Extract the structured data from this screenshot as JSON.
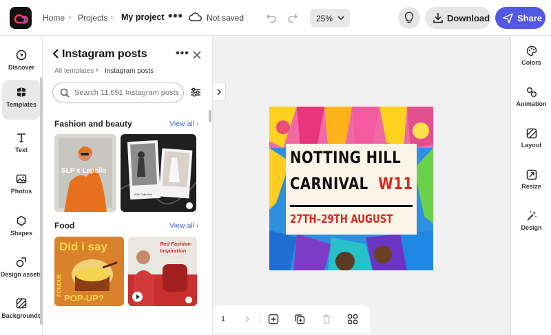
{
  "header": {
    "breadcrumb": [
      "Home",
      "Projects",
      "My project"
    ],
    "more_label": "•••",
    "save_status": "Not saved",
    "zoom": "25%",
    "download_label": "Download",
    "share_label": "Share"
  },
  "left_rail": {
    "items": [
      {
        "label": "Discover",
        "icon": "compass-icon"
      },
      {
        "label": "Templates",
        "icon": "templates-icon",
        "active": true
      },
      {
        "label": "Text",
        "icon": "text-icon"
      },
      {
        "label": "Photos",
        "icon": "photo-icon"
      },
      {
        "label": "Shapes",
        "icon": "shapes-icon"
      },
      {
        "label": "Design assets",
        "icon": "design-assets-icon"
      },
      {
        "label": "Backgrounds",
        "icon": "backgrounds-icon"
      }
    ]
  },
  "panel": {
    "title": "Instagram posts",
    "more_label": "•••",
    "breadcrumb_parent": "All templates",
    "breadcrumb_current": "Instagram posts",
    "search_placeholder": "Search 11,691 Instagram posts",
    "sections": [
      {
        "title": "Fashion and beauty",
        "view_all": "View all",
        "thumbs": [
          {
            "caption": "SLP x Lepsilo"
          },
          {
            "caption": "A/W Collection"
          }
        ]
      },
      {
        "title": "Food",
        "view_all": "View all",
        "thumbs": [
          {
            "caption_top": "Did i say",
            "caption_side": "FONDUE",
            "caption_bottom": "POP-UP?"
          },
          {
            "caption": "Red Fashion Inspiration"
          }
        ]
      }
    ]
  },
  "poster": {
    "line1": "NOTTING HILL",
    "line2": "CARNIVAL",
    "line2_accent": "W11",
    "dates": "27TH–29TH AUGUST",
    "text_color": "#111111",
    "accent_color": "#d8281d",
    "card_color": "#fbf4e8"
  },
  "pagebar": {
    "page_number": "1"
  },
  "right_rail": {
    "items": [
      {
        "label": "Colors",
        "icon": "palette-icon"
      },
      {
        "label": "Animation",
        "icon": "animation-icon"
      },
      {
        "label": "Layout",
        "icon": "layout-icon"
      },
      {
        "label": "Resize",
        "icon": "resize-icon"
      },
      {
        "label": "Design",
        "icon": "magic-wand-icon"
      }
    ]
  },
  "colors": {
    "share_button": "#5258e4",
    "link": "#3b64d6"
  }
}
